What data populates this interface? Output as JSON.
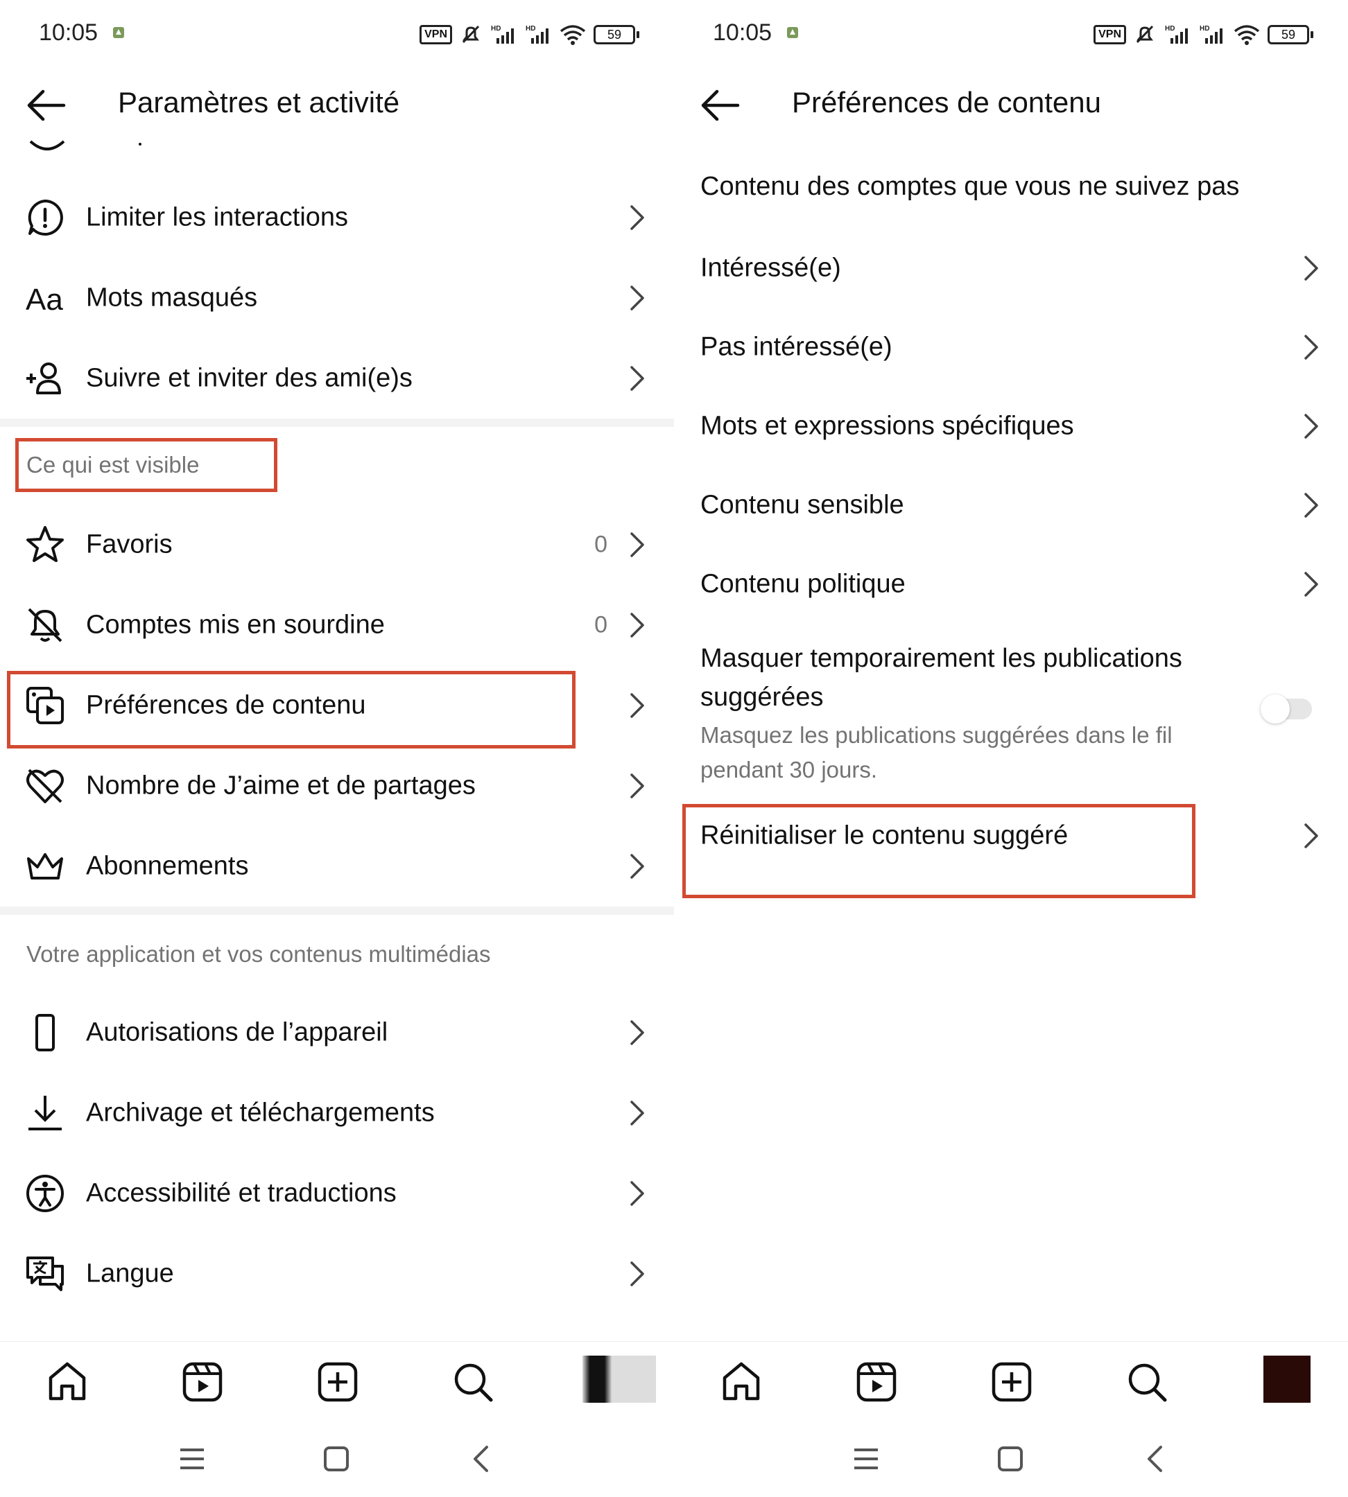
{
  "status_bar": {
    "time": "10:05",
    "vpn": "VPN",
    "battery": "59"
  },
  "left": {
    "title": "Paramètres et activité",
    "items_top": [
      {
        "label": "Limiter les interactions",
        "icon": "alert-circle-icon"
      },
      {
        "label": "Mots masqués",
        "icon": "text-aa-icon"
      },
      {
        "label": "Suivre et inviter des ami(e)s",
        "icon": "add-person-icon"
      }
    ],
    "section_visible": "Ce qui est visible",
    "items_visible": [
      {
        "label": "Favoris",
        "count": "0",
        "icon": "star-icon"
      },
      {
        "label": "Comptes mis en sourdine",
        "count": "0",
        "icon": "muted-bell-icon"
      },
      {
        "label": "Préférences de contenu",
        "count": "",
        "icon": "media-content-icon"
      },
      {
        "label": "Nombre de J’aime et de partages",
        "count": "",
        "icon": "heart-off-icon"
      },
      {
        "label": "Abonnements",
        "count": "",
        "icon": "crown-icon"
      }
    ],
    "section_app": "Votre application et vos contenus multimédias",
    "items_app": [
      {
        "label": "Autorisations de l’appareil",
        "icon": "phone-icon"
      },
      {
        "label": "Archivage et téléchargements",
        "icon": "download-icon"
      },
      {
        "label": "Accessibilité et traductions",
        "icon": "accessibility-icon"
      },
      {
        "label": "Langue",
        "icon": "translate-icon"
      }
    ]
  },
  "right": {
    "title": "Préférences de contenu",
    "section_header": "Contenu des comptes que vous ne suivez pas",
    "items": [
      {
        "label": "Intéressé(e)"
      },
      {
        "label": "Pas intéressé(e)"
      },
      {
        "label": "Mots et expressions spécifiques"
      },
      {
        "label": "Contenu sensible"
      },
      {
        "label": "Contenu politique"
      }
    ],
    "toggle": {
      "title_line1": "Masquer temporairement les publications",
      "title_line2": "suggérées",
      "desc_line1": "Masquez les publications suggérées dans le fil",
      "desc_line2": "pendant 30 jours.",
      "on": false
    },
    "reset": {
      "label": "Réinitialiser le contenu suggéré"
    }
  },
  "colors": {
    "highlight": "#d24a32",
    "text": "#111111",
    "secondary": "#737373",
    "separator": "#f3f3f3"
  }
}
